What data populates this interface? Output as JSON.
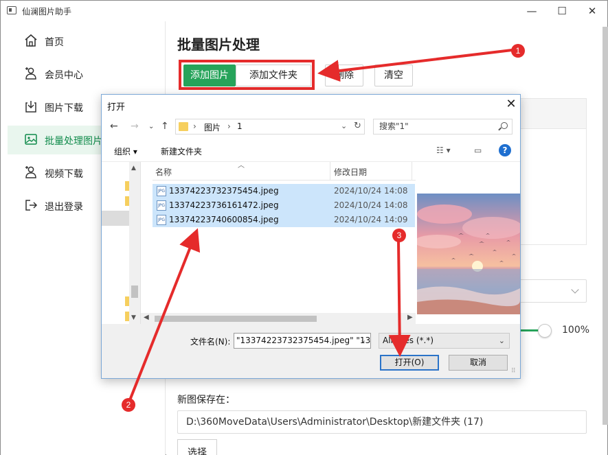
{
  "app": {
    "title": "仙澜图片助手"
  },
  "window_controls": {
    "min": "—",
    "max": "☐",
    "close": "✕"
  },
  "sidebar": {
    "items": [
      {
        "label": "首页",
        "icon": "home-icon"
      },
      {
        "label": "会员中心",
        "icon": "user-plus-icon"
      },
      {
        "label": "图片下载",
        "icon": "download-icon"
      },
      {
        "label": "批量处理图片",
        "icon": "image-icon",
        "active": true
      },
      {
        "label": "视频下载",
        "icon": "user-plus-icon"
      },
      {
        "label": "退出登录",
        "icon": "logout-icon"
      }
    ]
  },
  "main": {
    "title": "批量图片处理",
    "toolbar": {
      "add_image": "添加图片",
      "add_folder": "添加文件夹",
      "delete": "删除",
      "clear": "清空"
    },
    "quality_percent": "100%",
    "save_label": "新图保存在：",
    "save_path": "D:\\360MoveData\\Users\\Administrator\\Desktop\\新建文件夹 (17)",
    "choose_button": "选择"
  },
  "dialog": {
    "title": "打开",
    "close": "✕",
    "address": {
      "parts": [
        "图片",
        "1"
      ]
    },
    "search_placeholder": "搜索\"1\"",
    "commands": {
      "organize": "组织 ▾",
      "new_folder": "新建文件夹"
    },
    "columns": {
      "name": "名称",
      "date": "修改日期"
    },
    "files": [
      {
        "name": "13374223732375454.jpeg",
        "date": "2024/10/24 14:08"
      },
      {
        "name": "13374223736161472.jpeg",
        "date": "2024/10/24 14:08"
      },
      {
        "name": "13374223740600854.jpeg",
        "date": "2024/10/24 14:09"
      }
    ],
    "filename_label": "文件名(N):",
    "filename_value": "\"13374223732375454.jpeg\" \"13",
    "filetype": "All Files (*.*)",
    "open_button": "打开(O)",
    "cancel_button": "取消"
  },
  "annotations": {
    "badge1": "1",
    "badge2": "2",
    "badge3": "3"
  },
  "colors": {
    "accent_green": "#26a35a",
    "annotation_red": "#e52b2b",
    "selection_blue": "#cce5fb"
  }
}
